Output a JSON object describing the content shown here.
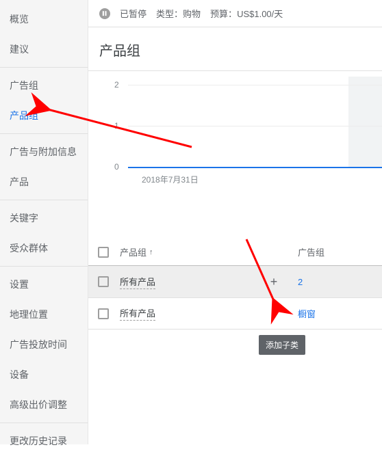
{
  "sidebar": {
    "items": [
      {
        "label": "概览"
      },
      {
        "label": "建议"
      },
      {
        "label": "广告组"
      },
      {
        "label": "产品组",
        "active": true
      },
      {
        "label": "广告与附加信息"
      },
      {
        "label": "产品"
      },
      {
        "label": "关键字"
      },
      {
        "label": "受众群体"
      },
      {
        "label": "设置"
      },
      {
        "label": "地理位置"
      },
      {
        "label": "广告投放时间"
      },
      {
        "label": "设备"
      },
      {
        "label": "高级出价调整"
      },
      {
        "label": "更改历史记录"
      }
    ]
  },
  "topbar": {
    "status": "已暂停",
    "type_label": "类型：",
    "type_value": "购物",
    "budget_label": "预算：",
    "budget_value": "US$1.00/天"
  },
  "header": {
    "title": "产品组"
  },
  "chart_data": {
    "type": "line",
    "y_ticks": [
      0,
      1,
      2
    ],
    "x_labels": [
      "2018年7月31日"
    ],
    "ylim": [
      0,
      2
    ],
    "series": [
      {
        "name": "",
        "values": [
          0
        ]
      }
    ]
  },
  "table": {
    "header": {
      "product_col": "产品组",
      "adgroup_col": "广告组"
    },
    "rows": [
      {
        "product": "所有产品",
        "adgroup": "2",
        "highlighted": true,
        "show_plus": true
      },
      {
        "product": "所有产品",
        "adgroup_text": "橱窗",
        "highlighted": false,
        "show_plus": false
      }
    ]
  },
  "tooltip": {
    "text": "添加子类"
  }
}
